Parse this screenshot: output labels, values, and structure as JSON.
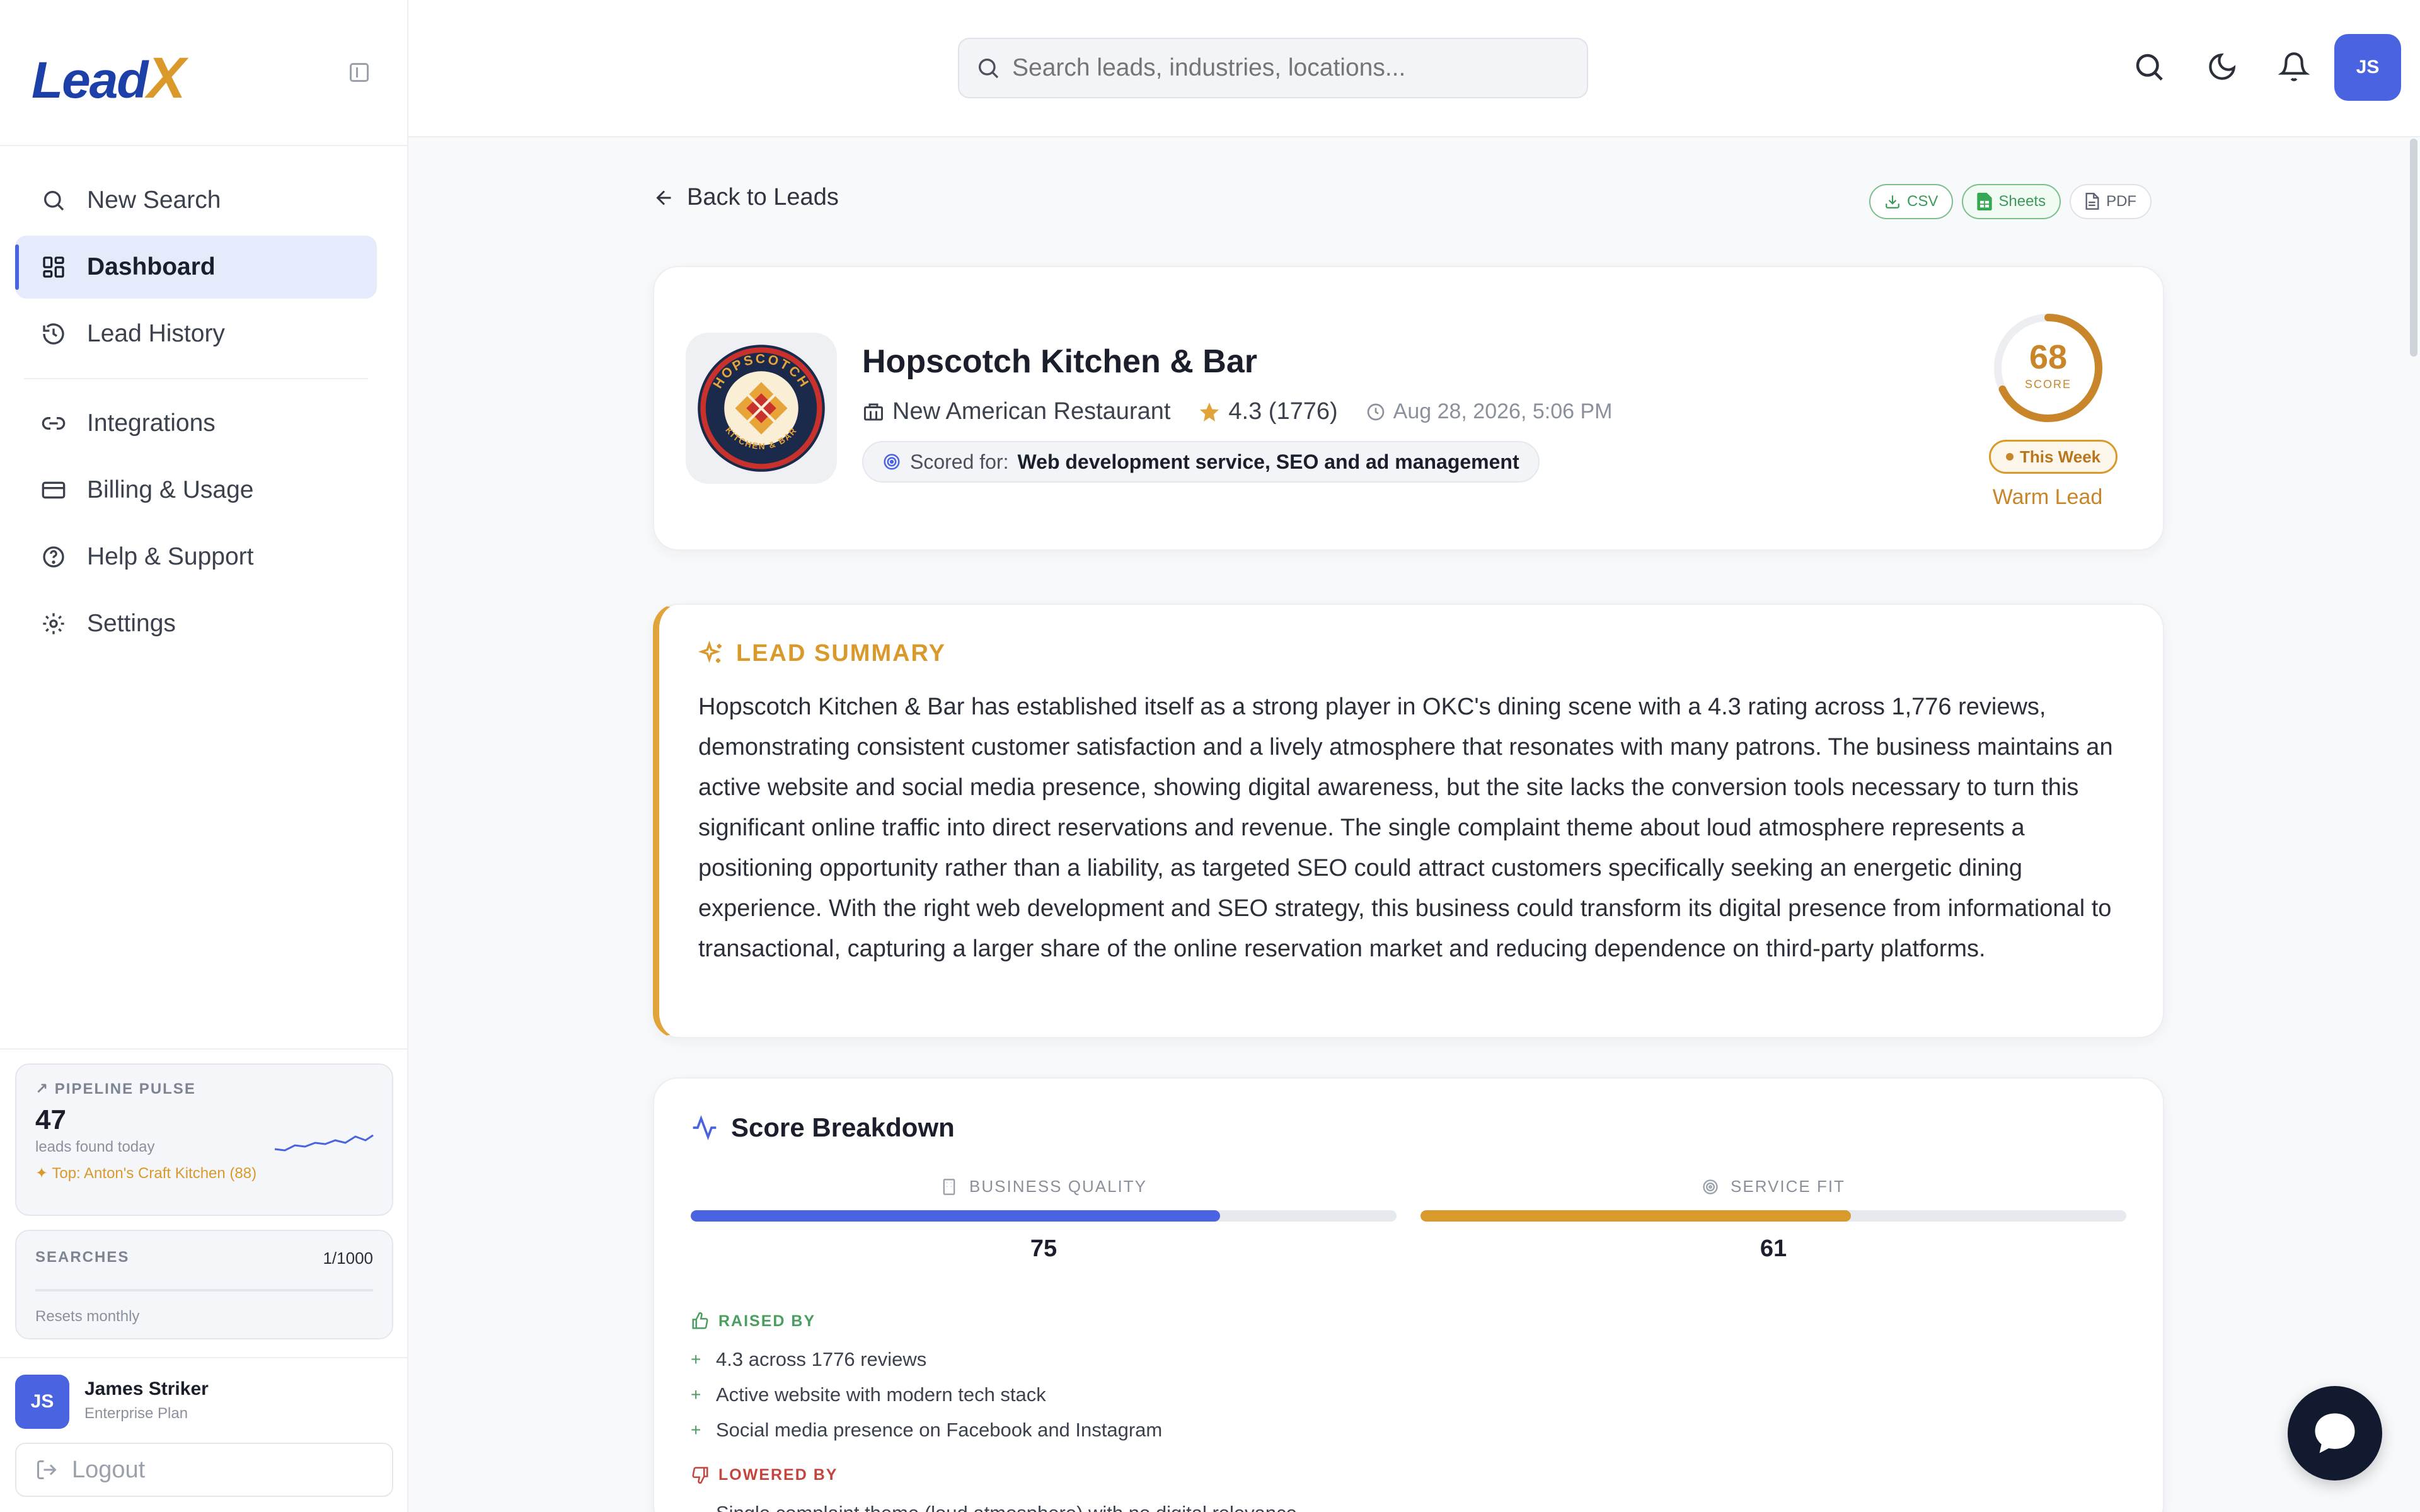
{
  "brand": {
    "name_part1": "Lead",
    "name_part2": "X"
  },
  "sidebar": {
    "nav": [
      {
        "label": "New Search",
        "icon": "search-icon"
      },
      {
        "label": "Dashboard",
        "icon": "dashboard-icon",
        "active": true
      },
      {
        "label": "Lead History",
        "icon": "history-icon"
      },
      {
        "label": "Integrations",
        "icon": "link-icon"
      },
      {
        "label": "Billing & Usage",
        "icon": "card-icon"
      },
      {
        "label": "Help & Support",
        "icon": "help-icon"
      },
      {
        "label": "Settings",
        "icon": "gear-icon"
      }
    ],
    "pulse": {
      "label": "PIPELINE PULSE",
      "count": "47",
      "sub": "leads found today",
      "top": "Top: Anton's Craft Kitchen (88)"
    },
    "searches": {
      "label": "SEARCHES",
      "count": "1/1000",
      "used_fraction": 0.001,
      "note": "Resets monthly"
    },
    "user": {
      "initials": "JS",
      "name": "James Striker",
      "plan": "Enterprise Plan"
    },
    "logout_label": "Logout"
  },
  "header": {
    "search_placeholder": "Search leads, industries, locations...",
    "avatar_initials": "JS"
  },
  "page": {
    "back_label": "Back to Leads",
    "exports": {
      "csv": "CSV",
      "sheets": "Sheets",
      "pdf": "PDF"
    }
  },
  "lead": {
    "name": "Hopscotch Kitchen & Bar",
    "category": "New American Restaurant",
    "rating": "4.3 (1776)",
    "timestamp": "Aug 28, 2026, 5:06 PM",
    "scored_for_label": "Scored for:",
    "scored_for": "Web development service, SEO and ad management",
    "score": "68",
    "score_value": 68,
    "score_label": "SCORE",
    "badge": "This Week",
    "temperature": "Warm Lead",
    "logo_text_top": "HOPSCOTCH",
    "logo_text_bottom": "KITCHEN & BAR"
  },
  "summary": {
    "title": "LEAD SUMMARY",
    "text": "Hopscotch Kitchen & Bar has established itself as a strong player in OKC's dining scene with a 4.3 rating across 1,776 reviews, demonstrating consistent customer satisfaction and a lively atmosphere that resonates with many patrons. The business maintains an active website and social media presence, showing digital awareness, but the site lacks the conversion tools necessary to turn this significant online traffic into direct reservations and revenue. The single complaint theme about loud atmosphere represents a positioning opportunity rather than a liability, as targeted SEO could attract customers specifically seeking an energetic dining experience. With the right web development and SEO strategy, this business could transform its digital presence from informational to transactional, capturing a larger share of the online reservation market and reducing dependence on third-party platforms."
  },
  "breakdown": {
    "title": "Score Breakdown",
    "business_quality": {
      "label": "BUSINESS QUALITY",
      "value": "75",
      "pct": 75,
      "color": "#4a63e0"
    },
    "service_fit": {
      "label": "SERVICE FIT",
      "value": "61",
      "pct": 61,
      "color": "#d99a2b"
    },
    "raised_label": "RAISED BY",
    "raised": [
      "4.3 across 1776 reviews",
      "Active website with modern tech stack",
      "Social media presence on Facebook and Instagram"
    ],
    "lowered_label": "LOWERED BY",
    "lowered": [
      "Single complaint theme (loud atmosphere) with no digital relevance"
    ]
  },
  "colors": {
    "accent": "#4a63e0",
    "gold": "#d99a2b",
    "positive": "#4a9e5f",
    "negative": "#c4453e"
  }
}
